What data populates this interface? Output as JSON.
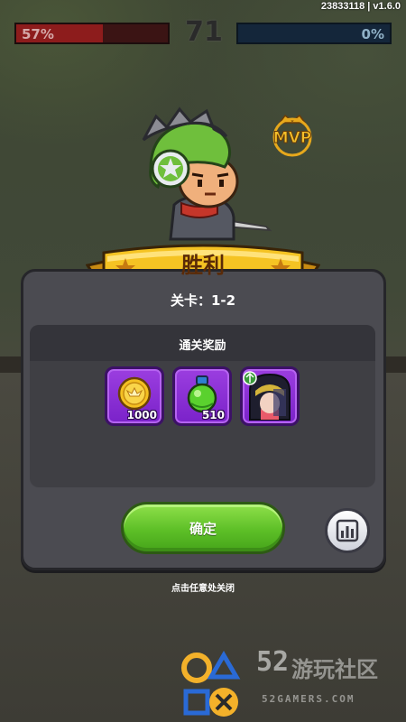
{
  "hud": {
    "build": "23833118 | v1.6.0",
    "left_percent_text": "57%",
    "left_fill": 0.57,
    "score": "71",
    "right_percent_text": "0%",
    "right_fill": 0.0
  },
  "result": {
    "title": "胜利",
    "stage_label": "关卡：1-2",
    "mvp_label": "MVP"
  },
  "rewards": {
    "title": "通关奖励",
    "items": [
      {
        "icon": "gold-coin-icon",
        "count": "1000"
      },
      {
        "icon": "green-potion-icon",
        "count": "510"
      },
      {
        "icon": "hero-portrait-icon",
        "count": ""
      }
    ]
  },
  "actions": {
    "confirm_label": "确定",
    "stats_icon": "bar-chart-icon",
    "close_hint": "点击任意处关闭"
  },
  "watermark": {
    "number": "52",
    "name": "游玩社区",
    "url": "52GAMERS.COM"
  },
  "colors": {
    "panel": "#4b4b51",
    "item_bg": "#8a30d6",
    "confirm_green": "#5dbf27",
    "ribbon_gold": "#f5c323"
  }
}
